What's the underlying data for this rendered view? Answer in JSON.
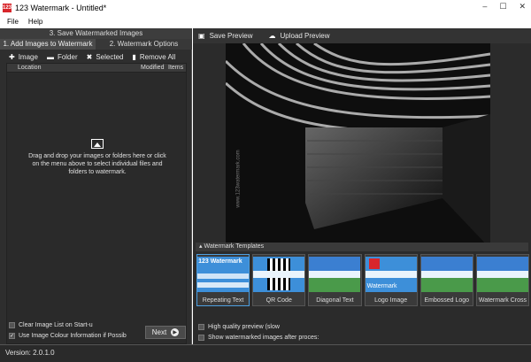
{
  "window": {
    "title": "123 Watermark - Untitled*",
    "logo_text": "123",
    "controls": [
      "–",
      "☐",
      "✕"
    ]
  },
  "menu": {
    "items": [
      "File",
      "Help"
    ]
  },
  "steps": {
    "step3": "3. Save Watermarked Images",
    "step1": "1. Add Images to Watermark",
    "step2": "2. Watermark Options"
  },
  "toolbar": {
    "image": "Image",
    "folder": "Folder",
    "selected": "Selected",
    "remove_all": "Remove All"
  },
  "file_list": {
    "columns": {
      "location": "Location",
      "modified": "Modified",
      "items": "Items"
    },
    "drop_hint": "Drag and drop your images or folders here or click on the menu above to select individual files and folders to watermark."
  },
  "left_options": {
    "clear_list": {
      "label": "Clear Image List on Start-u",
      "checked": false
    },
    "use_colour": {
      "label": "Use Image Colour Information if Possib",
      "checked": true
    }
  },
  "next_button": "Next",
  "preview_toolbar": {
    "save": "Save Preview",
    "upload": "Upload Preview"
  },
  "preview": {
    "watermark_text": "www.123watermark.com"
  },
  "templates": {
    "header": "Watermark Templates",
    "items": [
      {
        "label": "Repeating Text",
        "thumb_text": "123 Watermark"
      },
      {
        "label": "QR Code",
        "thumb_text": ""
      },
      {
        "label": "Diagonal Text",
        "thumb_text": ""
      },
      {
        "label": "Logo Image",
        "thumb_text": "Watermark"
      },
      {
        "label": "Embossed Logo",
        "thumb_text": ""
      },
      {
        "label": "Watermark Cross",
        "thumb_text": ""
      }
    ]
  },
  "right_options": {
    "high_quality": {
      "label": "High quality preview (slow",
      "checked": false
    },
    "show_after": {
      "label": "Show watermarked images after proces:",
      "checked": false
    }
  },
  "status": {
    "version": "Version: 2.0.1.0"
  },
  "colors": {
    "accent": "#4d9fe0",
    "logo": "#d8262b",
    "panel": "#2e2e2e"
  }
}
